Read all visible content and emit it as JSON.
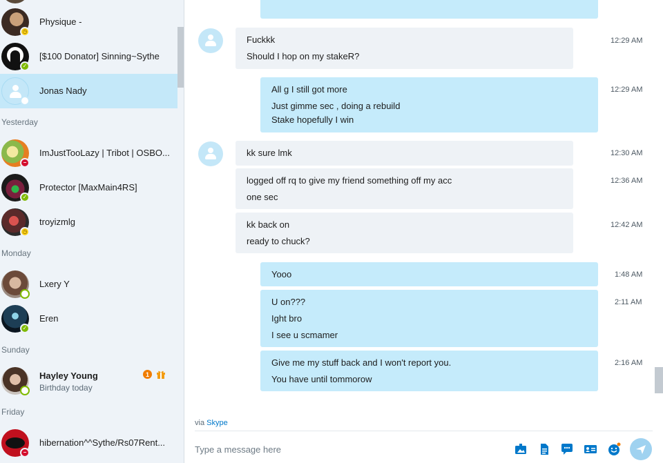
{
  "sidebar": {
    "contacts_top": [
      {
        "name": "Physique -",
        "status": "away"
      },
      {
        "name": "[$100 Donator] Sinning~Sythe",
        "status": "online"
      },
      {
        "name": "Jonas Nady",
        "status": "offline",
        "selected": true
      }
    ],
    "sections": [
      {
        "label": "Yesterday"
      },
      {
        "label": "Monday"
      },
      {
        "label": "Sunday"
      },
      {
        "label": "Friday"
      }
    ],
    "yesterday": [
      {
        "name": "ImJustTooLazy | Tribot | OSBO...",
        "status": "busy"
      },
      {
        "name": "Protector [MaxMain4RS]",
        "status": "online"
      },
      {
        "name": "troyizmlg",
        "status": "away"
      }
    ],
    "monday": [
      {
        "name": "Lxery Y",
        "status": "offline"
      },
      {
        "name": "Eren",
        "status": "online"
      }
    ],
    "sunday": [
      {
        "name": "Hayley Young",
        "sub": "Birthday today",
        "badge": "1",
        "status": "offline"
      }
    ],
    "friday": [
      {
        "name": "hibernation^^Sythe/Rs07Rent...",
        "status": "busy"
      }
    ]
  },
  "chat": {
    "messages": [
      {
        "dir": "in",
        "lines": [
          "Fuckkk",
          "Should I hop on my stakeR?"
        ],
        "time": "12:29 AM"
      },
      {
        "dir": "out",
        "lines": [
          "All g I still got more",
          "Just gimme sec , doing a rebuild",
          "Stake hopefully I win"
        ],
        "time": "12:29 AM"
      },
      {
        "dir": "in",
        "lines": [
          "kk sure lmk"
        ],
        "time": "12:30 AM"
      },
      {
        "dir": "in",
        "lines": [
          "logged off rq to give my friend something off my acc",
          "one sec"
        ],
        "time": "12:36 AM"
      },
      {
        "dir": "in",
        "lines": [
          "kk back on",
          "ready to chuck?"
        ],
        "time": "12:42 AM"
      },
      {
        "dir": "out",
        "lines": [
          "Yooo"
        ],
        "time": "1:48 AM"
      },
      {
        "dir": "out",
        "lines": [
          "U on???",
          "Ight bro",
          "I see u scmamer"
        ],
        "time": "2:11 AM"
      },
      {
        "dir": "out",
        "lines": [
          "Give me my stuff back and I won't report you.",
          "You have until tommorow"
        ],
        "time": "2:16 AM"
      }
    ],
    "via_prefix": "via",
    "via_link": "Skype",
    "compose_placeholder": "Type a message here"
  },
  "colors": {
    "accent": "#00aff0",
    "incoming_bubble": "#eef2f6",
    "outgoing_bubble": "#c5ebfb",
    "selected_contact": "#c4e8f9"
  },
  "icons": [
    "media-icon",
    "file-icon",
    "chat-bubble-icon",
    "contact-card-icon",
    "emoticon-icon",
    "send-icon",
    "gift-icon"
  ]
}
